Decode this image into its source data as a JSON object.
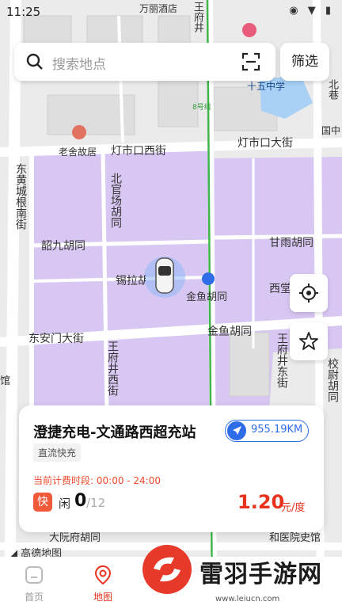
{
  "status_bar": {
    "time": "11:25",
    "icons": "◉ ▼ ▮"
  },
  "search": {
    "placeholder": "搜索地点",
    "filter_label": "筛选"
  },
  "map": {
    "labels": [
      "万丽酒店",
      "王府井",
      "十五中学",
      "北巷",
      "国中",
      "8号线",
      "老舍故居",
      "灯市口西街",
      "灯市口大街",
      "东黄城根南街",
      "北官场胡同",
      "韶九胡同",
      "甘雨胡同",
      "锡拉胡同",
      "金鱼胡同",
      "西堂",
      "东安门大街",
      "金鱼胡同",
      "王府井西街",
      "王府井东街",
      "校尉胡同",
      "大阮府胡同",
      "和医院史馆",
      "馆"
    ],
    "attribution": "高德地图"
  },
  "station": {
    "name": "澄捷充电-文通路西超充站",
    "distance": "955.19KM",
    "tag": "直流快充",
    "period_label": "当前计费时段:",
    "period": "00:00 - 24:00",
    "fast_badge": "快",
    "idle_label": "闲",
    "idle_count": "0",
    "total": "/12",
    "price": "1.20",
    "unit": "元/度"
  },
  "nav": {
    "items": [
      {
        "label": "首页"
      },
      {
        "label": "地图"
      }
    ]
  },
  "watermark": {
    "text": "雷羽手游网",
    "url": "www.leiucn.com"
  },
  "colors": {
    "accent": "#e8321e",
    "blue": "#2f6de8",
    "district": "#d9c7f3"
  }
}
